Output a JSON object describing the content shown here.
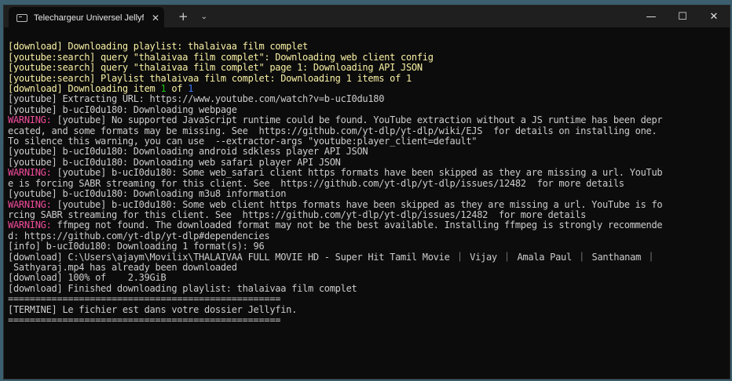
{
  "window": {
    "tab_title": "Telechargeur Universel Jellyfi",
    "tab_close": "✕",
    "new_tab": "+",
    "tab_dropdown": "⌄",
    "minimize": "—",
    "maximize": "☐",
    "close": "✕"
  },
  "terminal": {
    "lines": [
      "[download] Downloading playlist: thalaivaa film complet",
      "[youtube:search] query \"thalaivaa film complet\": Downloading web client config",
      "[youtube:search] query \"thalaivaa film complet\" page 1: Downloading API JSON",
      "[youtube:search] Playlist thalaivaa film complet: Downloading 1 items of 1",
      {
        "pre": "[download] Downloading item ",
        "n1": "1",
        "mid": " of ",
        "n2": "1"
      },
      "[youtube] Extracting URL: https://www.youtube.com/watch?v=b-ucI0du180",
      "[youtube] b-ucI0du180: Downloading webpage",
      {
        "warn": "WARNING:",
        "text": " [youtube] No supported JavaScript runtime could be found. YouTube extraction without a JS runtime has been depr"
      },
      "ecated, and some formats may be missing. See  https://github.com/yt-dlp/yt-dlp/wiki/EJS  for details on installing one.",
      "To silence this warning, you can use  --extractor-args \"youtube:player_client=default\"",
      "[youtube] b-ucI0du180: Downloading android sdkless player API JSON",
      "[youtube] b-ucI0du180: Downloading web safari player API JSON",
      {
        "warn": "WARNING:",
        "text": " [youtube] b-ucI0du180: Some web_safari client https formats have been skipped as they are missing a url. YouTub"
      },
      "e is forcing SABR streaming for this client. See  https://github.com/yt-dlp/yt-dlp/issues/12482  for more details",
      "[youtube] b-ucI0du180: Downloading m3u8 information",
      {
        "warn": "WARNING:",
        "text": " [youtube] b-ucI0du180: Some web client https formats have been skipped as they are missing a url. YouTube is fo"
      },
      "rcing SABR streaming for this client. See  https://github.com/yt-dlp/yt-dlp/issues/12482  for more details",
      {
        "warn": "WARNING:",
        "text": " ffmpeg not found. The downloaded format may not be the best available. Installing ffmpeg is strongly recommende"
      },
      "d: https://github.com/yt-dlp/yt-dlp#dependencies",
      "[info] b-ucI0du180: Downloading 1 format(s): 96",
      "[download] C:\\Users\\ajaym\\Movilix\\THALAIVAA FULL MOVIE HD - Super Hit Tamil Movie ｜ Vijay ｜ Amala Paul ｜ Santhanam ｜",
      " Sathyaraj.mp4 has already been downloaded",
      "[download] 100% of    2.39GiB",
      "[download] Finished downloading playlist: thalaivaa film complet",
      "",
      "==================================================",
      "[TERMINE] Le fichier est dans votre dossier Jellyfin.",
      "=================================================="
    ]
  },
  "colors": {
    "yellow_text": "#f9f1a5",
    "warning": "#f14c9b",
    "number_green": "#16c60c",
    "number_blue": "#3b78ff",
    "default_text": "#cccccc",
    "background": "#0c0c0c"
  }
}
